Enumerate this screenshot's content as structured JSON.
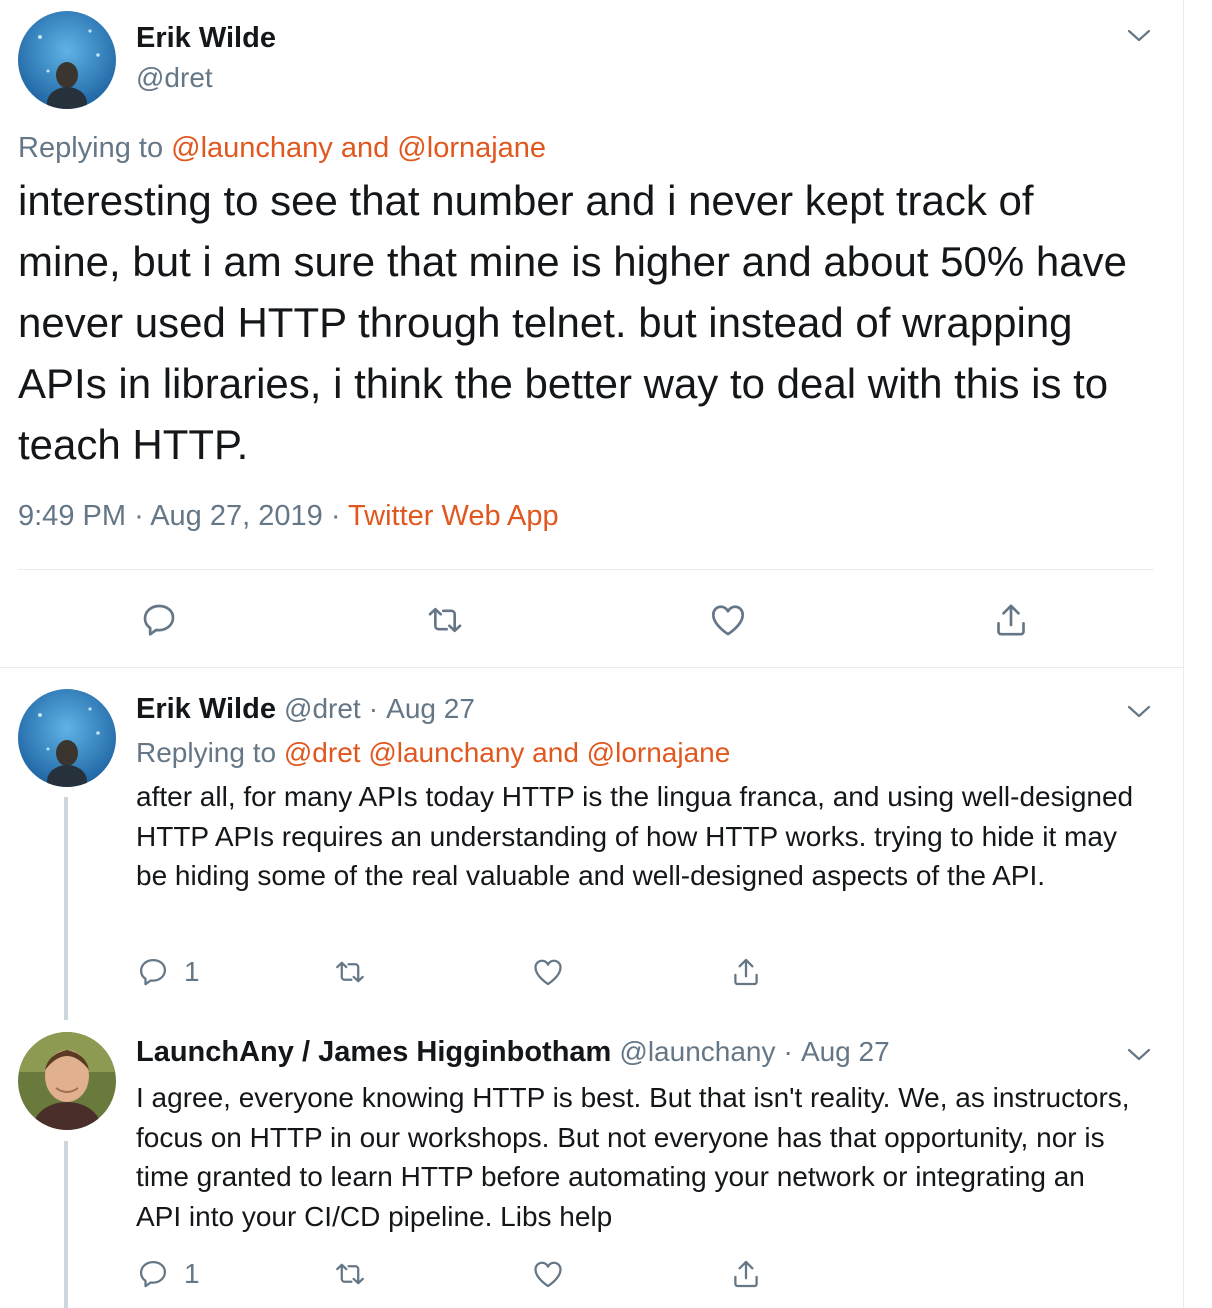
{
  "main_tweet": {
    "author_name": "Erik Wilde",
    "author_handle": "@dret",
    "replying_prefix": "Replying to",
    "replying_links": "@launchany and @lornajane",
    "text": "interesting to see that number and i never kept track of mine, but i am sure that mine is higher and about 50% have never used HTTP through telnet. but instead of wrapping APIs in libraries, i think the better way to deal with this is to teach HTTP.",
    "time": "9:49 PM",
    "date": "Aug 27, 2019",
    "separator": "·",
    "source": "Twitter Web App"
  },
  "replies": [
    {
      "author_name": "Erik Wilde",
      "author_handle": "@dret",
      "date": "Aug 27",
      "replying_prefix": "Replying to",
      "replying_links": "@dret @launchany and @lornajane",
      "text": "after all, for many APIs today HTTP is the lingua franca, and using well-designed HTTP APIs requires an understanding of how HTTP works. trying to hide it may be hiding some of the real valuable and well-designed aspects of the API.",
      "reply_count": "1"
    },
    {
      "author_name": "LaunchAny / James Higginbotham",
      "author_handle": "@launchany",
      "date": "Aug 27",
      "text": "I agree, everyone knowing HTTP is best. But that isn't reality. We, as instructors, focus on HTTP in our workshops. But not everyone has that opportunity, nor is time granted to learn HTTP before automating your network or integrating an API into your CI/CD pipeline. Libs help",
      "reply_count": "1"
    }
  ],
  "icons": {
    "reply": "reply-icon",
    "retweet": "retweet-icon",
    "like": "heart-icon",
    "share": "share-icon",
    "more": "chevron-down-icon"
  },
  "colors": {
    "accent": "#e0581f",
    "secondary_text": "#657786",
    "primary_text": "#14171a",
    "divider": "#e6ecf0",
    "thread_line": "#ccd6dd"
  }
}
